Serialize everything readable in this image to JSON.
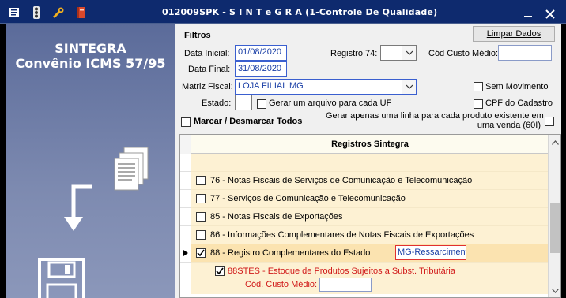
{
  "window": {
    "title": "012009SPK - S I N T e G R A (1-Controle De Qualidade)",
    "minimize_symbol": "—",
    "close_symbol": "✕",
    "icons": [
      "menu-icon",
      "traffic-light-icon",
      "tools-icon",
      "book-icon"
    ]
  },
  "left_panel": {
    "title_line1": "SINTEGRA",
    "title_line2": "Convênio ICMS 57/95",
    "icons": [
      "documents-icon",
      "arrow-down-icon",
      "floppy-disk-icon"
    ]
  },
  "filters": {
    "group_label": "Filtros",
    "clear_button": "Limpar Dados",
    "data_inicial_label": "Data Inicial:",
    "data_inicial_value": "01/08/2020",
    "data_final_label": "Data Final:",
    "data_final_value": "31/08/2020",
    "registro74_label": "Registro 74:",
    "registro74_value": "",
    "cod_custo_medio_label": "Cód Custo Médio:",
    "cod_custo_medio_value": "",
    "matriz_fiscal_label": "Matriz Fiscal:",
    "matriz_fiscal_value": "LOJA FILIAL MG",
    "sem_movimento_label": "Sem Movimento",
    "estado_label": "Estado:",
    "estado_value": "",
    "gerar_arquivo_label": "Gerar um arquivo para cada UF",
    "cpf_cadastro_label": "CPF do Cadastro",
    "marcar_label": "Marcar / Desmarcar Todos",
    "gerar_linha_label_line1": "Gerar apenas uma linha para cada produto existente em",
    "gerar_linha_label_line2": "uma venda (60I)"
  },
  "grid": {
    "header": "Registros Sintegra",
    "rows": [
      {
        "label": "76 - Notas Fiscais de Serviços de Comunicação e Telecomunicação",
        "checked": false
      },
      {
        "label": "77 - Serviços de Comunicação e Telecomunicação",
        "checked": false
      },
      {
        "label": "85 - Notas Fiscais de Exportações",
        "checked": false
      },
      {
        "label": "86 - Informações Complementares de Notas Fiscais de Exportações",
        "checked": false
      },
      {
        "label": "88 - Registro Complementares do Estado",
        "checked": true,
        "extra": "MG-Ressarcimento",
        "current": true
      }
    ],
    "sub_item": {
      "label": "88STES - Estoque de Produtos Sujeitos a Subst. Tributária",
      "checked": true,
      "cod_label": "Cód. Custo Médio:",
      "cod_value": ""
    }
  },
  "colors": {
    "title_bar": "#0e2a6e",
    "row_background": "#fdf1d3",
    "sub_item_text": "#d01818",
    "field_text": "#1a3fa6"
  }
}
